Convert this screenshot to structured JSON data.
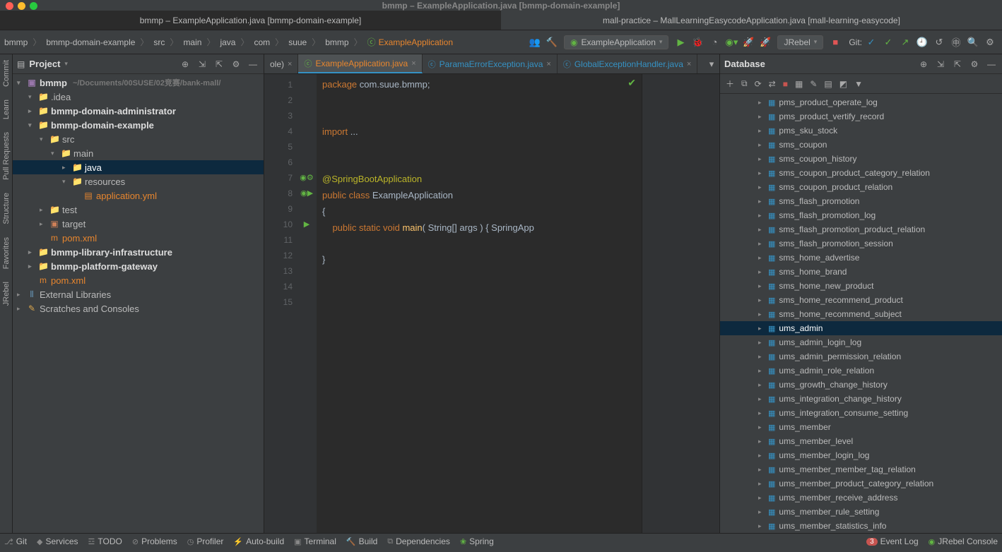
{
  "titlebar": "bmmp – ExampleApplication.java [bmmp-domain-example]",
  "project_tabs": [
    {
      "label": "bmmp – ExampleApplication.java [bmmp-domain-example]",
      "active": true
    },
    {
      "label": "mall-practice – MallLearningEasycodeApplication.java [mall-learning-easycode]",
      "active": false
    }
  ],
  "breadcrumbs": [
    "bmmp",
    "bmmp-domain-example",
    "src",
    "main",
    "java",
    "com",
    "suue",
    "bmmp"
  ],
  "breadcrumbs_class": "ExampleApplication",
  "run_config": "ExampleApplication",
  "jrebel_label": "JRebel",
  "git_label": "Git:",
  "left_gutter": [
    "Commit",
    "Learn",
    "Pull Requests",
    "Structure",
    "Favorites",
    "JRebel"
  ],
  "project_panel": {
    "title": "Project",
    "root": {
      "name": "bmmp",
      "path": "~/Documents/00SUSE/02竞赛/bank-mall/"
    },
    "items": [
      {
        "indent": 1,
        "arrow": "▾",
        "icon": "folder",
        "label": ".idea"
      },
      {
        "indent": 1,
        "arrow": "▸",
        "icon": "folder",
        "label": "bmmp-domain-administrator",
        "bold": true
      },
      {
        "indent": 1,
        "arrow": "▾",
        "icon": "folder",
        "label": "bmmp-domain-example",
        "bold": true
      },
      {
        "indent": 2,
        "arrow": "▾",
        "icon": "folder",
        "label": "src"
      },
      {
        "indent": 3,
        "arrow": "▾",
        "icon": "folder",
        "label": "main"
      },
      {
        "indent": 4,
        "arrow": "▸",
        "icon": "folder",
        "label": "java",
        "selected": true
      },
      {
        "indent": 4,
        "arrow": "▾",
        "icon": "folder",
        "label": "resources"
      },
      {
        "indent": 5,
        "arrow": "",
        "icon": "yml",
        "label": "application.yml",
        "orange": true
      },
      {
        "indent": 2,
        "arrow": "▸",
        "icon": "folder",
        "label": "test"
      },
      {
        "indent": 2,
        "arrow": "▸",
        "icon": "package",
        "label": "target"
      },
      {
        "indent": 2,
        "arrow": "",
        "icon": "pom",
        "label": "pom.xml",
        "orange": true
      },
      {
        "indent": 1,
        "arrow": "▸",
        "icon": "folder",
        "label": "bmmp-library-infrastructure",
        "bold": true
      },
      {
        "indent": 1,
        "arrow": "▸",
        "icon": "folder",
        "label": "bmmp-platform-gateway",
        "bold": true
      },
      {
        "indent": 1,
        "arrow": "",
        "icon": "pom",
        "label": "pom.xml",
        "orange": true
      }
    ],
    "external": "External Libraries",
    "scratches": "Scratches and Consoles"
  },
  "editor": {
    "tabs": [
      {
        "label": "ole)",
        "short": true
      },
      {
        "label": "ExampleApplication.java",
        "active": true,
        "color": "orange"
      },
      {
        "label": "ParamaErrorException.java",
        "color": "teal"
      },
      {
        "label": "GlobalExceptionHandler.java",
        "color": "teal"
      }
    ],
    "lines": [
      "1",
      "2",
      "3",
      "4",
      "5",
      "6",
      "7",
      "8",
      "9",
      "10",
      "11",
      "12",
      "13",
      "14",
      "15"
    ],
    "code": {
      "l1_kw": "package",
      "l1_pkg": " com.suue.bmmp;",
      "l4_kw": "import",
      "l4_rest": " ...",
      "l7_ann": "@SpringBootApplication",
      "l8_kw": "public class",
      "l8_name": " ExampleApplication",
      "l9": "{",
      "l10_kw": "    public static void",
      "l10_name": " main",
      "l10_sig": "( String[] args ) {",
      "l10_call": " SpringApp",
      "l12": "}"
    }
  },
  "database": {
    "title": "Database",
    "tables": [
      "pms_product_operate_log",
      "pms_product_vertify_record",
      "pms_sku_stock",
      "sms_coupon",
      "sms_coupon_history",
      "sms_coupon_product_category_relation",
      "sms_coupon_product_relation",
      "sms_flash_promotion",
      "sms_flash_promotion_log",
      "sms_flash_promotion_product_relation",
      "sms_flash_promotion_session",
      "sms_home_advertise",
      "sms_home_brand",
      "sms_home_new_product",
      "sms_home_recommend_product",
      "sms_home_recommend_subject",
      "ums_admin",
      "ums_admin_login_log",
      "ums_admin_permission_relation",
      "ums_admin_role_relation",
      "ums_growth_change_history",
      "ums_integration_change_history",
      "ums_integration_consume_setting",
      "ums_member",
      "ums_member_level",
      "ums_member_login_log",
      "ums_member_member_tag_relation",
      "ums_member_product_category_relation",
      "ums_member_receive_address",
      "ums_member_rule_setting",
      "ums_member_statistics_info"
    ],
    "selected": "ums_admin"
  },
  "bottom": {
    "items": [
      "Git",
      "Services",
      "TODO",
      "Problems",
      "Profiler",
      "Auto-build",
      "Terminal",
      "Build",
      "Dependencies",
      "Spring"
    ],
    "event_count": "3",
    "event_log": "Event Log",
    "jrebel": "JRebel Console"
  }
}
